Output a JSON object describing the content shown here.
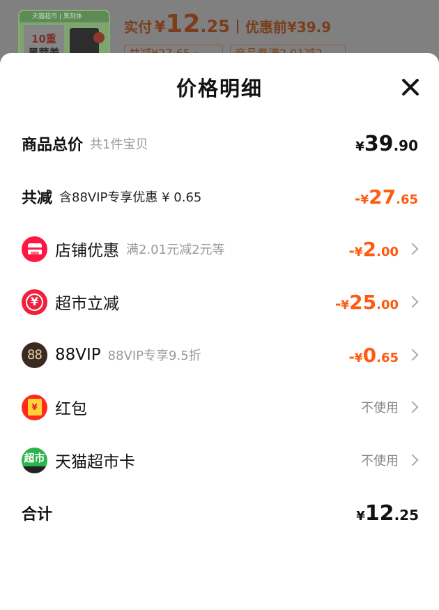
{
  "background": {
    "thumb_top": "天猫超市 | 黑刻体",
    "thumb_badge_line1": "10重",
    "thumb_badge_line2": "黑营养",
    "paid_label": "实付",
    "yen": "¥",
    "paid_int": "12",
    "paid_dec": ".25",
    "orig_label": "优惠前",
    "orig_price": "¥39.9",
    "tag_saved": "共减¥27.65 ›",
    "tag_offer": "商品券满2.01减2"
  },
  "sheet": {
    "title": "价格明细",
    "close_icon": "close-icon"
  },
  "rows": {
    "total": {
      "label": "商品总价",
      "sub": "共1件宝贝",
      "yen": "¥",
      "int": "39",
      "dec": ".90"
    },
    "reduction": {
      "label": "共减",
      "sub": "含88VIP专享优惠 ¥ 0.65",
      "sign": "-",
      "yen": "¥",
      "int": "27",
      "dec": ".65"
    },
    "shop": {
      "label": "店铺优惠",
      "sub": "满2.01元减2元等",
      "sign": "-",
      "yen": "¥",
      "int": "2",
      "dec": ".00",
      "icon": "shop-coupon-icon"
    },
    "market": {
      "label": "超市立减",
      "sign": "-",
      "yen": "¥",
      "int": "25",
      "dec": ".00",
      "icon_char": "¥",
      "icon": "market-reduce-icon"
    },
    "vip": {
      "label": "88VIP",
      "sub": "88VIP专享9.5折",
      "sign": "-",
      "yen": "¥",
      "int": "0",
      "dec": ".65",
      "icon_text": "88",
      "icon": "vip-88-icon"
    },
    "redpack": {
      "label": "红包",
      "status": "不使用",
      "icon_char": "¥",
      "icon": "red-packet-icon"
    },
    "card": {
      "label": "天猫超市卡",
      "status": "不使用",
      "icon_text": "超市",
      "icon": "tmall-card-icon"
    },
    "sum": {
      "label": "合计",
      "yen": "¥",
      "int": "12",
      "dec": ".25"
    }
  },
  "colors": {
    "accent_orange": "#ff5a12",
    "shop_red": "#ff1744",
    "card_green": "#2bb34c"
  }
}
